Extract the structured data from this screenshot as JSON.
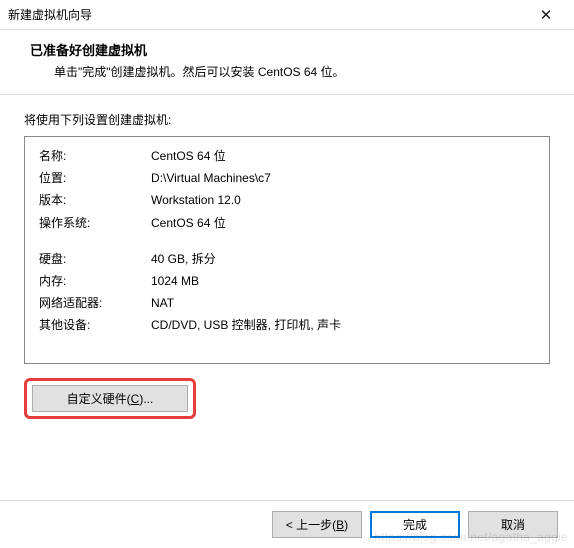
{
  "titlebar": {
    "title": "新建虚拟机向导"
  },
  "header": {
    "title": "已准备好创建虚拟机",
    "subtitle": "单击\"完成\"创建虚拟机。然后可以安装 CentOS 64 位。"
  },
  "body": {
    "label": "将使用下列设置创建虚拟机:",
    "rows1": [
      {
        "key": "名称:",
        "val": "CentOS 64 位"
      },
      {
        "key": "位置:",
        "val": "D:\\Virtual Machines\\c7"
      },
      {
        "key": "版本:",
        "val": "Workstation 12.0"
      },
      {
        "key": "操作系统:",
        "val": "CentOS 64 位"
      }
    ],
    "rows2": [
      {
        "key": "硬盘:",
        "val": "40 GB, 拆分"
      },
      {
        "key": "内存:",
        "val": "1024 MB"
      },
      {
        "key": "网络适配器:",
        "val": "NAT"
      },
      {
        "key": "其他设备:",
        "val": "CD/DVD, USB 控制器, 打印机, 声卡"
      }
    ]
  },
  "buttons": {
    "customize_pre": "自定义硬件(",
    "customize_u": "C",
    "customize_post": ")...",
    "back_pre": "< 上一步(",
    "back_u": "B",
    "back_post": ")",
    "finish": "完成",
    "cancel": "取消"
  },
  "watermark": "https://blog.csdn.net/agatha_aggie"
}
